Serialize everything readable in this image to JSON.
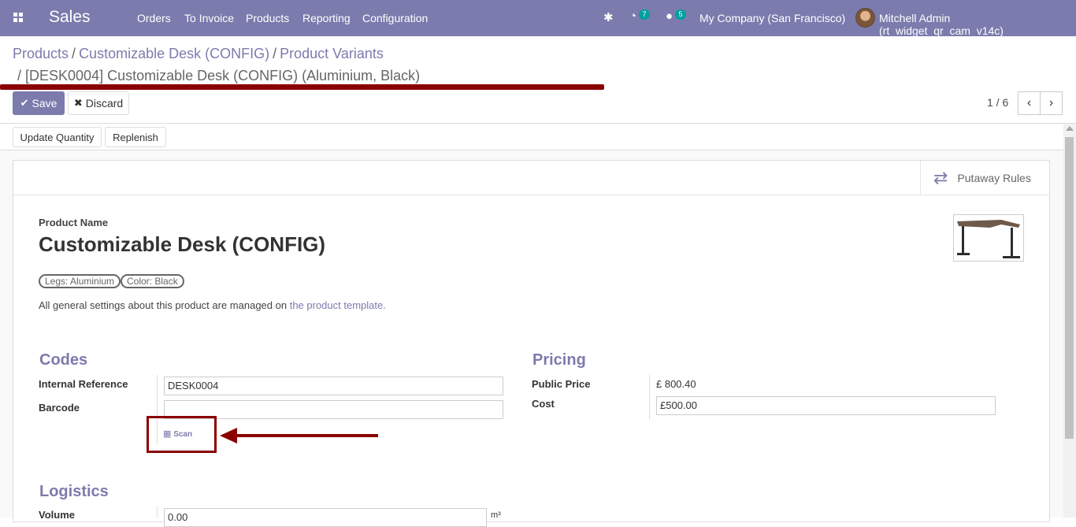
{
  "navbar": {
    "app_name": "Sales",
    "menu": [
      "Orders",
      "To Invoice",
      "Products",
      "Reporting",
      "Configuration"
    ],
    "activity_count": "7",
    "message_count": "5",
    "company": "My Company (San Francisco)",
    "user": "Mitchell Admin (rt_widget_qr_cam_v14c)"
  },
  "breadcrumb": {
    "items": [
      "Products",
      "Customizable Desk (CONFIG)",
      "Product Variants"
    ],
    "current": "[DESK0004] Customizable Desk (CONFIG) (Aluminium, Black)"
  },
  "control": {
    "save_label": "Save",
    "discard_label": "Discard",
    "pager": "1 / 6"
  },
  "status_buttons": [
    "Update Quantity",
    "Replenish"
  ],
  "smart_button": "Putaway Rules",
  "form": {
    "product_name_label": "Product Name",
    "product_name": "Customizable Desk (CONFIG)",
    "tags": [
      "Legs: Aluminium",
      "Color: Black"
    ],
    "info_text": "All general settings about this product are managed on ",
    "info_link": "the product template.",
    "codes": {
      "title": "Codes",
      "internal_ref_label": "Internal Reference",
      "internal_ref_value": "DESK0004",
      "barcode_label": "Barcode",
      "barcode_value": "",
      "scan_label": "Scan"
    },
    "pricing": {
      "title": "Pricing",
      "public_price_label": "Public Price",
      "public_price_value": "£ 800.40",
      "cost_label": "Cost",
      "cost_value": "£500.00"
    },
    "logistics": {
      "title": "Logistics",
      "volume_label": "Volume",
      "volume_value": "0.00",
      "volume_unit": "m³"
    }
  },
  "colors": {
    "brand": "#7c7bad",
    "annotation": "#8b0000",
    "badge": "#00a09d"
  }
}
